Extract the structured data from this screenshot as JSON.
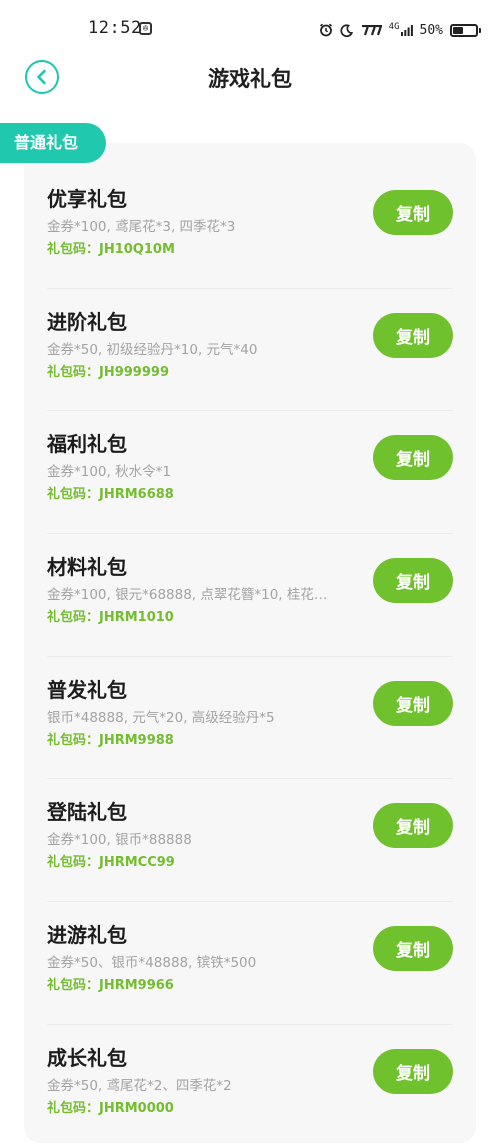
{
  "status_bar": {
    "time": "12:52",
    "network": "4G",
    "battery_percent": "50%",
    "battery_level": 0.5,
    "icons": [
      "app-notification-icon",
      "alarm-icon",
      "moon-icon",
      "hd-signal-icon",
      "cellular-signal-icon",
      "battery-icon"
    ]
  },
  "header": {
    "title": "游戏礼包",
    "back_icon": "chevron-left-icon"
  },
  "colors": {
    "accent_teal": "#20c9ad",
    "button_green": "#6fc12e",
    "code_green": "#73bd2f",
    "desc_gray": "#a3a3a3"
  },
  "category": {
    "label": "普通礼包"
  },
  "gifts": [
    {
      "name": "优享礼包",
      "desc": "金券*100, 鸢尾花*3, 四季花*3",
      "code": "礼包码：JH10Q10M",
      "button": "复制"
    },
    {
      "name": "进阶礼包",
      "desc": "金券*50, 初级经验丹*10, 元气*40",
      "code": "礼包码：JH999999",
      "button": "复制"
    },
    {
      "name": "福利礼包",
      "desc": "金券*100, 秋水令*1",
      "code": "礼包码：JHRM6688",
      "button": "复制"
    },
    {
      "name": "材料礼包",
      "desc": "金券*100, 银元*68888, 点翠花簪*10, 桂花…",
      "code": "礼包码：JHRM1010",
      "button": "复制"
    },
    {
      "name": "普发礼包",
      "desc": "银币*48888, 元气*20, 高级经验丹*5",
      "code": "礼包码：JHRM9988",
      "button": "复制"
    },
    {
      "name": "登陆礼包",
      "desc": "金券*100, 银币*88888",
      "code": "礼包码：JHRMCC99",
      "button": "复制"
    },
    {
      "name": "进游礼包",
      "desc": "金券*50、银币*48888, 镔铁*500",
      "code": "礼包码：JHRM9966",
      "button": "复制"
    },
    {
      "name": "成长礼包",
      "desc": "金券*50, 鸢尾花*2、四季花*2",
      "code": "礼包码：JHRM0000",
      "button": "复制"
    }
  ]
}
